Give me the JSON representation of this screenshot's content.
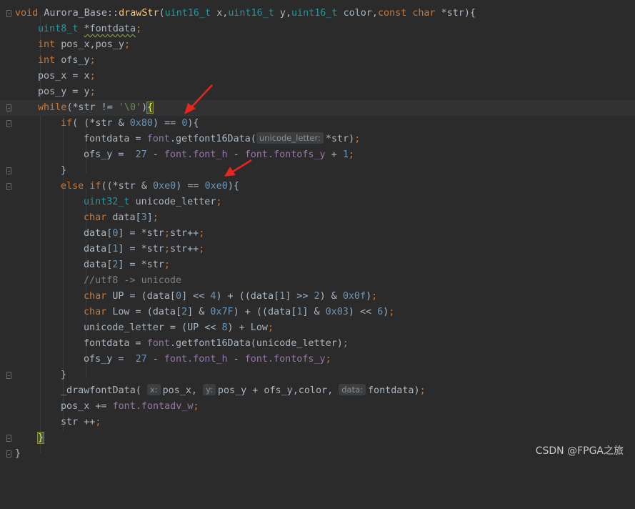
{
  "code": {
    "l01": {
      "kw": "void",
      "cls": "Aurora_Base",
      "sep": "::",
      "fn": "drawStr",
      "p1t": "uint16_t",
      "p1": "x",
      "p2t": "uint16_t",
      "p2": "y",
      "p3t": "uint16_t",
      "p3": "color",
      "cst": "const",
      "ch": "char",
      "p4": "*str",
      "close": "){"
    },
    "l02": {
      "t": "uint8_t",
      "v": "*fontdata",
      "s": ";"
    },
    "l03": {
      "t": "int",
      "v": "pos_x,pos_y",
      "s": ";"
    },
    "l04": {
      "t": "int",
      "v": "ofs_y",
      "s": ";"
    },
    "l05": {
      "v": "pos_x = x",
      "s": ";"
    },
    "l06": {
      "v": "pos_y = y",
      "s": ";"
    },
    "l07": {
      "kw": "while",
      "a": "(*str != ",
      "str": "'\\0'",
      "b": ")",
      "brace": "{"
    },
    "l08": {
      "kw": "if",
      "a": "( (*str & ",
      "n1": "0x80",
      "b": ") == ",
      "n2": "0",
      "c": "){"
    },
    "l09": {
      "a": "fontdata = ",
      "g": "font",
      "d": ".getfont16Data(",
      "hint": "unicode_letter:",
      "p": "*str",
      ")": ")",
      "s": ";"
    },
    "l10": {
      "a": "ofs_y =  ",
      "n1": "27",
      "b": " - ",
      "g1": "font",
      "m1": ".font_h",
      "c": " - ",
      "g2": "font",
      "m2": ".fontofs_y",
      "d": " + ",
      "n2": "1",
      "s": ";"
    },
    "l11": {
      "a": "}"
    },
    "l12": {
      "kw1": "else",
      "kw2": "if",
      "a": "((*str & ",
      "n1": "0xe0",
      "b": ") == ",
      "n2": "0xe0",
      "c": "){"
    },
    "l13": {
      "t": "uint32_t",
      "v": "unicode_letter",
      "s": ";"
    },
    "l14": {
      "t": "char",
      "v": "data[",
      "n": "3",
      "c": "]",
      "s": ";"
    },
    "l15": {
      "a": "data[",
      "n": "0",
      "b": "] = *str",
      "s1": ";",
      "c": "str++",
      "s2": ";"
    },
    "l16": {
      "a": "data[",
      "n": "1",
      "b": "] = *str",
      "s1": ";",
      "c": "str++",
      "s2": ";"
    },
    "l17": {
      "a": "data[",
      "n": "2",
      "b": "] = *str",
      "s": ";"
    },
    "l18": {
      "cmt": "//utf8 -> unicode"
    },
    "l19": {
      "t": "char",
      "a": "UP = (data[",
      "n1": "0",
      "b": "] << ",
      "n2": "4",
      "c": ") + ((data[",
      "n3": "1",
      "d": "] >> ",
      "n4": "2",
      "e": ") & ",
      "n5": "0x0f",
      "f": ")",
      "s": ";"
    },
    "l20": {
      "t": "char",
      "a": "Low = (data[",
      "n1": "2",
      "b": "] & ",
      "n2": "0x7F",
      "c": ") + ((data[",
      "n3": "1",
      "d": "] & ",
      "n4": "0x03",
      "e": ") << ",
      "n5": "6",
      "f": ")",
      "s": ";"
    },
    "l21": {
      "a": "unicode_letter = (UP << ",
      "n": "8",
      "b": ") + Low",
      "s": ";"
    },
    "l22": {
      "a": "fontdata = ",
      "g": "font",
      "d": ".getfont16Data(unicode_letter)",
      "s": ";"
    },
    "l23": {
      "a": "ofs_y =  ",
      "n1": "27",
      "b": " - ",
      "g1": "font",
      "m1": ".font_h",
      "c": " - ",
      "g2": "font",
      "m2": ".fontofs_y",
      "s": ";"
    },
    "l24": {
      "a": "}"
    },
    "l25": {
      "a": "_drawfontData( ",
      "h1": "x:",
      "b": "pos_x, ",
      "h2": "y:",
      "c": "pos_y + ofs_y,color, ",
      "h3": "data:",
      "d": "fontdata)",
      "s": ";"
    },
    "l26": {
      "a": "pos_x += ",
      "g": "font",
      "m": ".fontadv_w",
      "s": ";"
    },
    "l27": {
      "a": "str ++",
      "s": ";"
    },
    "l28": {
      "brace": "}"
    },
    "l29": {
      "a": "}"
    }
  },
  "watermark": "CSDN @FPGA之旅",
  "colors": {
    "background": "#2b2b2b",
    "annotation_arrow": "#e8261c"
  }
}
